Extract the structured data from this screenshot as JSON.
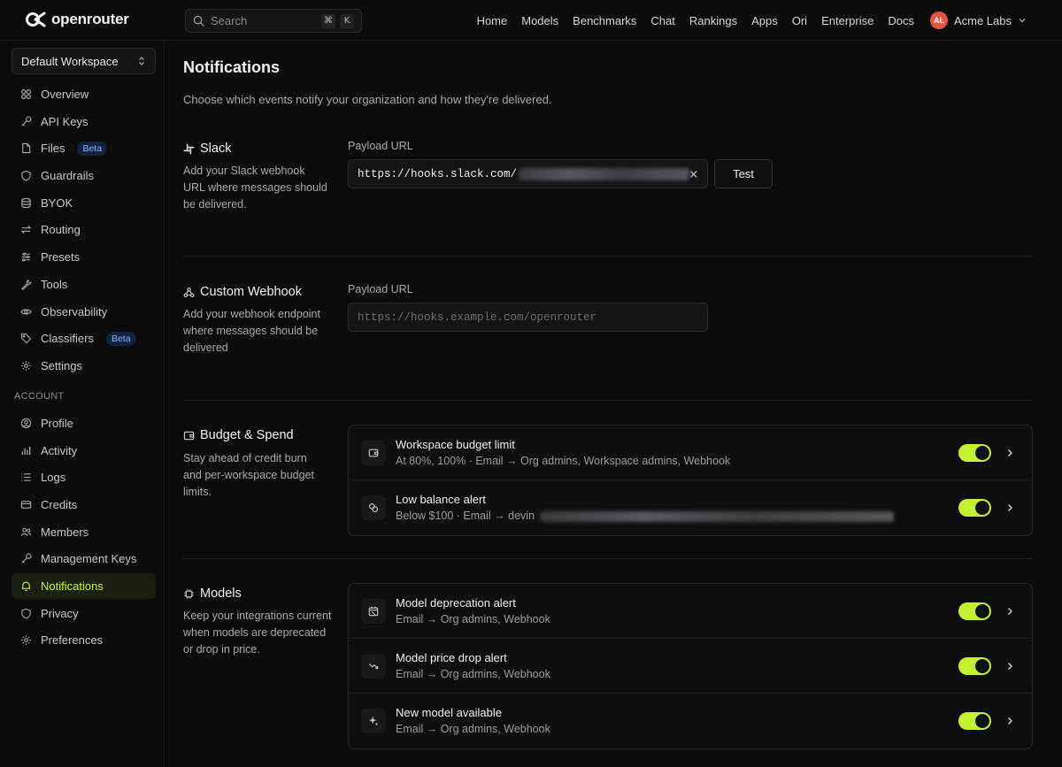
{
  "brand": {
    "name": "openrouter"
  },
  "search": {
    "placeholder": "Search",
    "kbd": [
      "⌘",
      "K"
    ]
  },
  "nav": [
    "Home",
    "Models",
    "Benchmarks",
    "Chat",
    "Rankings",
    "Apps",
    "Ori",
    "Enterprise",
    "Docs"
  ],
  "account": {
    "initials": "AL",
    "name": "Acme Labs"
  },
  "sidebar": {
    "workspace": "Default Workspace",
    "items": [
      {
        "label": "Overview",
        "icon": "grid-icon"
      },
      {
        "label": "API Keys",
        "icon": "key-icon"
      },
      {
        "label": "Files",
        "icon": "file-icon",
        "badge": "Beta"
      },
      {
        "label": "Guardrails",
        "icon": "shield-icon"
      },
      {
        "label": "BYOK",
        "icon": "database-icon"
      },
      {
        "label": "Routing",
        "icon": "arrows-icon"
      },
      {
        "label": "Presets",
        "icon": "sliders-icon"
      },
      {
        "label": "Tools",
        "icon": "wrench-icon"
      },
      {
        "label": "Observability",
        "icon": "eye-icon"
      },
      {
        "label": "Classifiers",
        "icon": "tag-icon",
        "badge": "Beta"
      },
      {
        "label": "Settings",
        "icon": "gear-icon"
      }
    ],
    "account_heading": "ACCOUNT",
    "account_items": [
      {
        "label": "Profile",
        "icon": "user-icon"
      },
      {
        "label": "Activity",
        "icon": "chart-icon"
      },
      {
        "label": "Logs",
        "icon": "list-icon"
      },
      {
        "label": "Credits",
        "icon": "card-icon"
      },
      {
        "label": "Members",
        "icon": "users-icon"
      },
      {
        "label": "Management Keys",
        "icon": "key-icon"
      },
      {
        "label": "Notifications",
        "icon": "bell-icon",
        "active": true
      },
      {
        "label": "Privacy",
        "icon": "shield-icon"
      },
      {
        "label": "Preferences",
        "icon": "gear-icon"
      }
    ]
  },
  "page": {
    "title": "Notifications",
    "description": "Choose which events notify your organization and how they're delivered."
  },
  "slack": {
    "title": "Slack",
    "description": "Add your Slack webhook URL where messages should be delivered.",
    "field_label": "Payload URL",
    "value": "https://hooks.slack.com/",
    "test_label": "Test"
  },
  "webhook": {
    "title": "Custom Webhook",
    "description": "Add your webhook endpoint where messages should be delivered",
    "field_label": "Payload URL",
    "placeholder": "https://hooks.example.com/openrouter"
  },
  "budget": {
    "title": "Budget & Spend",
    "description": "Stay ahead of credit burn and per-workspace budget limits.",
    "rows": [
      {
        "title": "Workspace budget limit",
        "subtitle": "At 80%, 100% · Email → Org admins, Workspace admins, Webhook",
        "icon": "wallet-icon",
        "enabled": true
      },
      {
        "title": "Low balance alert",
        "subtitle": "Below $100 · Email → devin",
        "icon": "coins-icon",
        "enabled": true
      }
    ]
  },
  "models": {
    "title": "Models",
    "description": "Keep your integrations current when models are deprecated or drop in price.",
    "rows": [
      {
        "title": "Model deprecation alert",
        "subtitle": "Email → Org admins, Webhook",
        "icon": "calendar-off-icon",
        "enabled": true
      },
      {
        "title": "Model price drop alert",
        "subtitle": "Email → Org admins, Webhook",
        "icon": "trend-down-icon",
        "enabled": true
      },
      {
        "title": "New model available",
        "subtitle": "Email → Org admins, Webhook",
        "icon": "sparkles-icon",
        "enabled": true
      }
    ]
  },
  "colors": {
    "accent": "#c3f12f",
    "background": "#0b0b0c",
    "avatar": "#e5553f",
    "beta": "#7fb4ff"
  }
}
